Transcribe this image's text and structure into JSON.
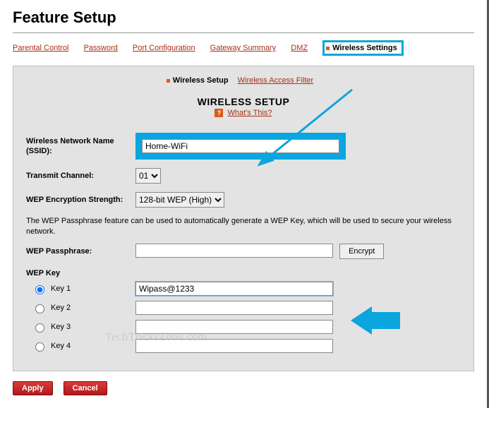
{
  "page_title": "Feature Setup",
  "tabs": {
    "parental": "Parental Control",
    "password": "Password",
    "portconf": "Port Configuration",
    "gwsummary": "Gateway Summary",
    "dmz": "DMZ",
    "wireless": "Wireless Settings"
  },
  "subtabs": {
    "setup": "Wireless Setup",
    "filter": "Wireless Access Filter"
  },
  "section_title": "WIRELESS SETUP",
  "whats_this": "What's This?",
  "labels": {
    "ssid": "Wireless Network Name (SSID):",
    "channel": "Transmit Channel:",
    "wepstrength": "WEP Encryption Strength:",
    "passphrase": "WEP Passphrase:",
    "wepkey_header": "WEP Key",
    "key1": "Key 1",
    "key2": "Key 2",
    "key3": "Key 3",
    "key4": "Key 4"
  },
  "values": {
    "ssid": "Home-WiFi",
    "channel": "01",
    "wepstrength": "128-bit WEP (High)",
    "passphrase": "",
    "key1": "Wipass@1233",
    "key2": "",
    "key3": "",
    "key4": "",
    "selected_key": "key1"
  },
  "note_text": "The WEP Passphrase feature can be used to automatically generate a WEP Key, which will be used to secure your wireless network.",
  "buttons": {
    "encrypt": "Encrypt",
    "apply": "Apply",
    "cancel": "Cancel"
  },
  "watermark": "TechTricksZone.com",
  "colors": {
    "highlight": "#0aa6df",
    "link": "#a83017",
    "accent": "#d85a1a",
    "button_red": "#c62222"
  }
}
